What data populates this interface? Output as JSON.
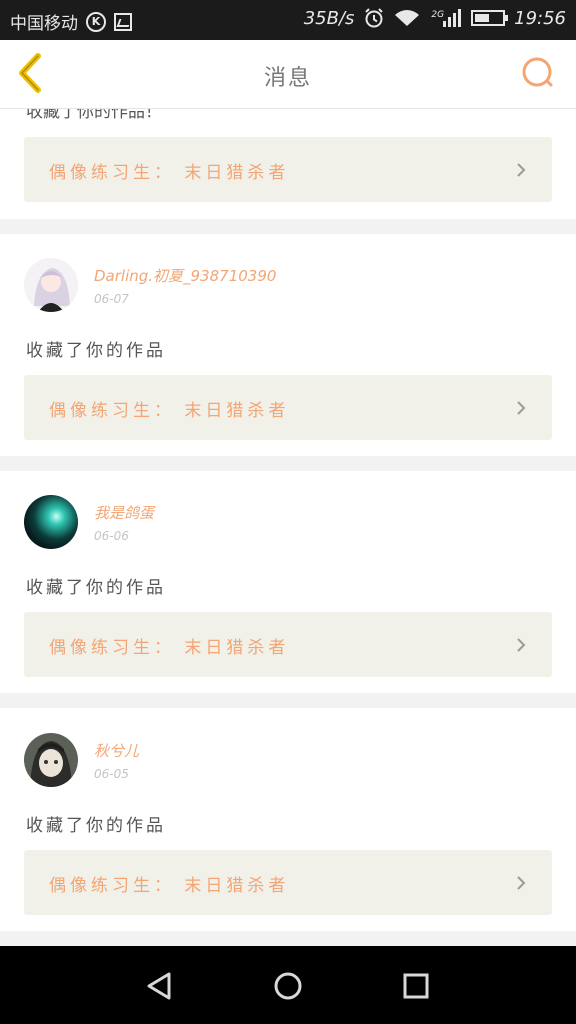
{
  "status_bar": {
    "carrier": "中国移动",
    "badge_k": "K",
    "speed": "35B/s",
    "network": "2G",
    "time": "19:56",
    "icons": [
      "k-badge-icon",
      "image-icon",
      "alarm-icon",
      "wifi-icon",
      "signal-icon",
      "battery-icon"
    ]
  },
  "header": {
    "title": "消息",
    "back_icon": "chevron-left-icon",
    "search_icon": "search-icon",
    "accent": "#f3a574",
    "back_color": "#f0c000"
  },
  "feed": {
    "partial": {
      "action_text": "收藏了你的作品！",
      "card_text": "偶像练习生： 末日猎杀者"
    },
    "posts": [
      {
        "username": "Darling.初夏_938710390",
        "date": "06-07",
        "action_text": "收藏了你的作品",
        "card_text": "偶像练习生： 末日猎杀者",
        "avatar": "anime-girl-avatar"
      },
      {
        "username": "我是鸽蛋",
        "date": "06-06",
        "action_text": "收藏了你的作品",
        "card_text": "偶像练习生： 末日猎杀者",
        "avatar": "teal-orb-avatar"
      },
      {
        "username": "秋兮儿",
        "date": "06-05",
        "action_text": "收藏了你的作品",
        "card_text": "偶像练习生： 末日猎杀者",
        "avatar": "portrait-avatar"
      }
    ]
  },
  "nav_bar": {
    "back_icon": "triangle-back-icon",
    "home_icon": "circle-home-icon",
    "recents_icon": "square-recents-icon"
  },
  "colors": {
    "card_bg": "#f1f0e9",
    "username": "#f3a574",
    "divider": "#f2f2f2"
  }
}
